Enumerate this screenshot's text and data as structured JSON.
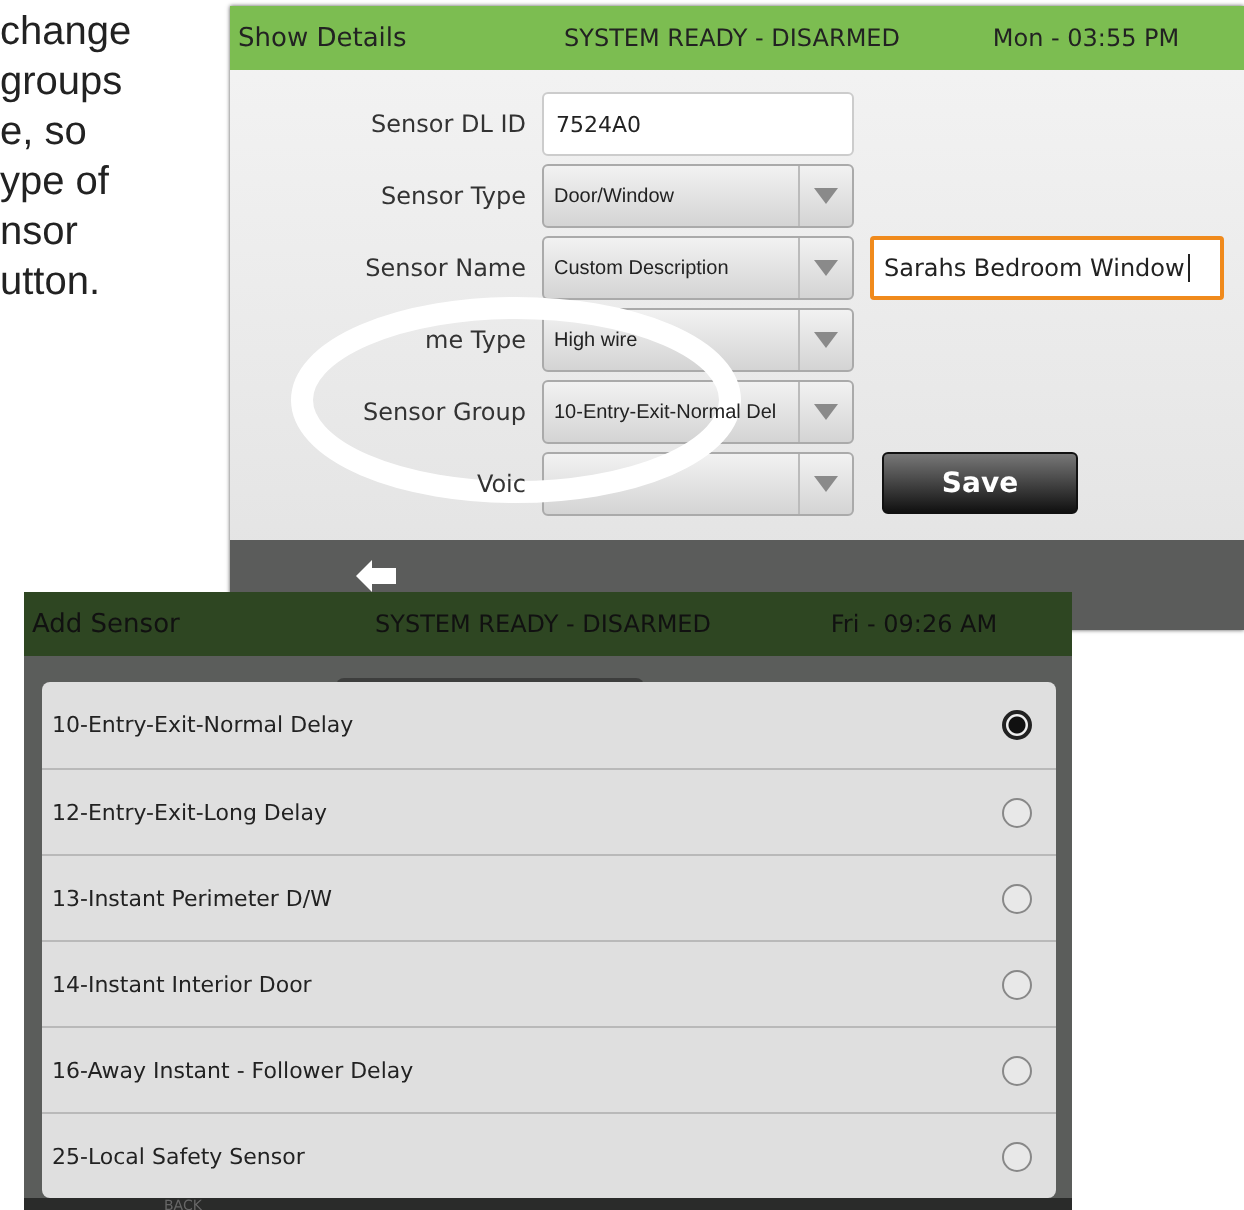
{
  "document_text": {
    "lines": [
      "change",
      "groups",
      "e, so",
      "ype of",
      "nsor",
      "utton."
    ]
  },
  "details_screen": {
    "header": {
      "title": "Show Details",
      "status": "SYSTEM READY - DISARMED",
      "time": "Mon - 03:55 PM"
    },
    "fields": [
      {
        "label": "Sensor DL ID",
        "kind": "text",
        "value": "7524A0"
      },
      {
        "label": "Sensor Type",
        "kind": "dropdown",
        "value": "Door/Window"
      },
      {
        "label": "Sensor Name",
        "kind": "dropdown",
        "value": "Custom Description"
      },
      {
        "label": "me Type",
        "kind": "dropdown",
        "value": "High wire"
      },
      {
        "label": "Sensor Group",
        "kind": "dropdown",
        "value": "10-Entry-Exit-Normal Del"
      },
      {
        "label": "Voic",
        "kind": "dropdown"
      }
    ],
    "name_entry": {
      "value": "Sarahs Bedroom Window",
      "focused": true
    },
    "save_button": "Save"
  },
  "add_sensor_screen": {
    "header": {
      "title": "Add Sensor",
      "status": "SYSTEM READY - DISARMED",
      "time": "Fri - 09:26 AM"
    },
    "options": [
      {
        "label": "10-Entry-Exit-Normal Delay",
        "selected": true
      },
      {
        "label": "12-Entry-Exit-Long Delay",
        "selected": false
      },
      {
        "label": "13-Instant Perimeter D/W",
        "selected": false
      },
      {
        "label": "14-Instant Interior Door",
        "selected": false
      },
      {
        "label": "16-Away Instant - Follower Delay",
        "selected": false
      },
      {
        "label": "25-Local Safety Sensor",
        "selected": false
      }
    ],
    "back_label": "BACK"
  }
}
